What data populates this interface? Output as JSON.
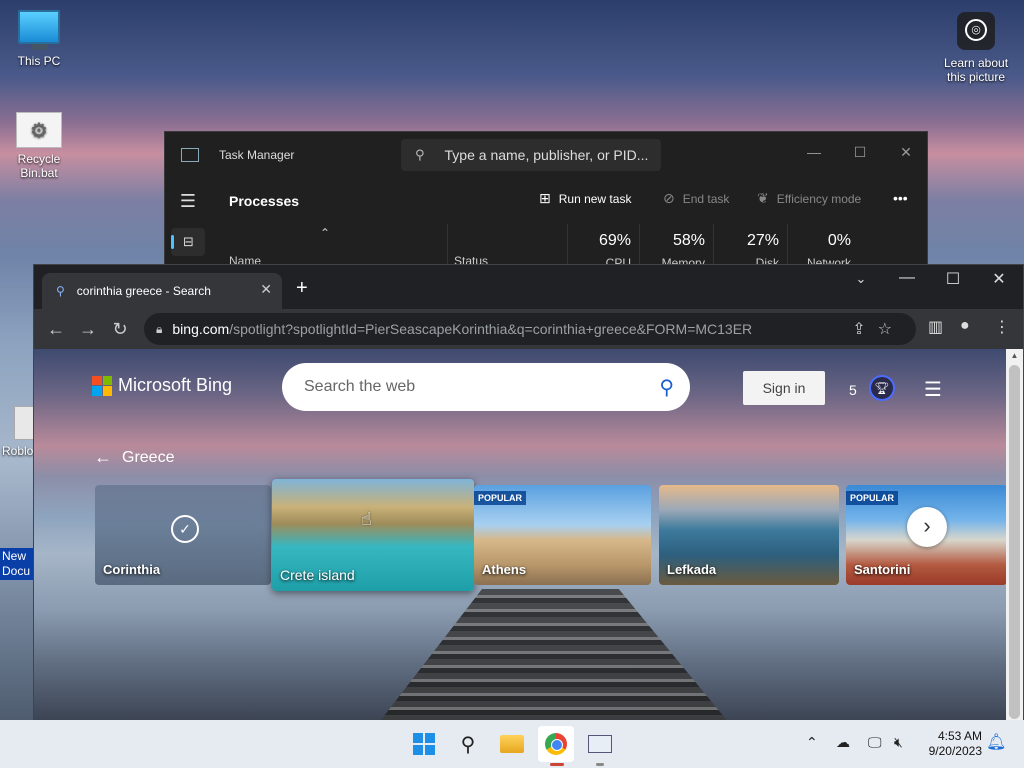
{
  "desktop": {
    "icons": [
      {
        "label": "This PC"
      },
      {
        "label": "Recycle Bin.bat"
      },
      {
        "label": "Roblo"
      }
    ],
    "selected_doc_label": "New Docu",
    "learn_label": "Learn about this picture"
  },
  "task_manager": {
    "title": "Task Manager",
    "search_placeholder": "Type a name, publisher, or PID...",
    "section": "Processes",
    "toolbar": {
      "run_new_task": "Run new task",
      "end_task": "End task",
      "efficiency_mode": "Efficiency mode",
      "more": "•••"
    },
    "columns": {
      "name": "Name",
      "status": "Status",
      "cpu": {
        "pct": "69%",
        "label": "CPU"
      },
      "memory": {
        "pct": "58%",
        "label": "Memory"
      },
      "disk": {
        "pct": "27%",
        "label": "Disk"
      },
      "network": {
        "pct": "0%",
        "label": "Network"
      }
    }
  },
  "browser": {
    "tab_title": "corinthia greece - Search",
    "url_host": "bing.com",
    "url_path": "/spotlight?spotlightId=PierSeascapeKorinthia&q=corinthia+greece&FORM=MC13ER",
    "bing": {
      "logo_text": "Microsoft Bing",
      "search_placeholder": "Search the web",
      "sign_in": "Sign in",
      "rewards_count": "5",
      "back_label": "Greece",
      "cards": [
        {
          "name": "Corinthia",
          "badge": ""
        },
        {
          "name": "Crete island",
          "badge": ""
        },
        {
          "name": "Athens",
          "badge": "POPULAR"
        },
        {
          "name": "Lefkada",
          "badge": ""
        },
        {
          "name": "Santorini",
          "badge": "POPULAR"
        }
      ]
    }
  },
  "taskbar": {
    "time": "4:53 AM",
    "date": "9/20/2023"
  },
  "colors": {
    "accent": "#4cc2ff",
    "bing_search_icon": "#1a5fd0",
    "taskbar_bg": "#e6ebf2"
  }
}
